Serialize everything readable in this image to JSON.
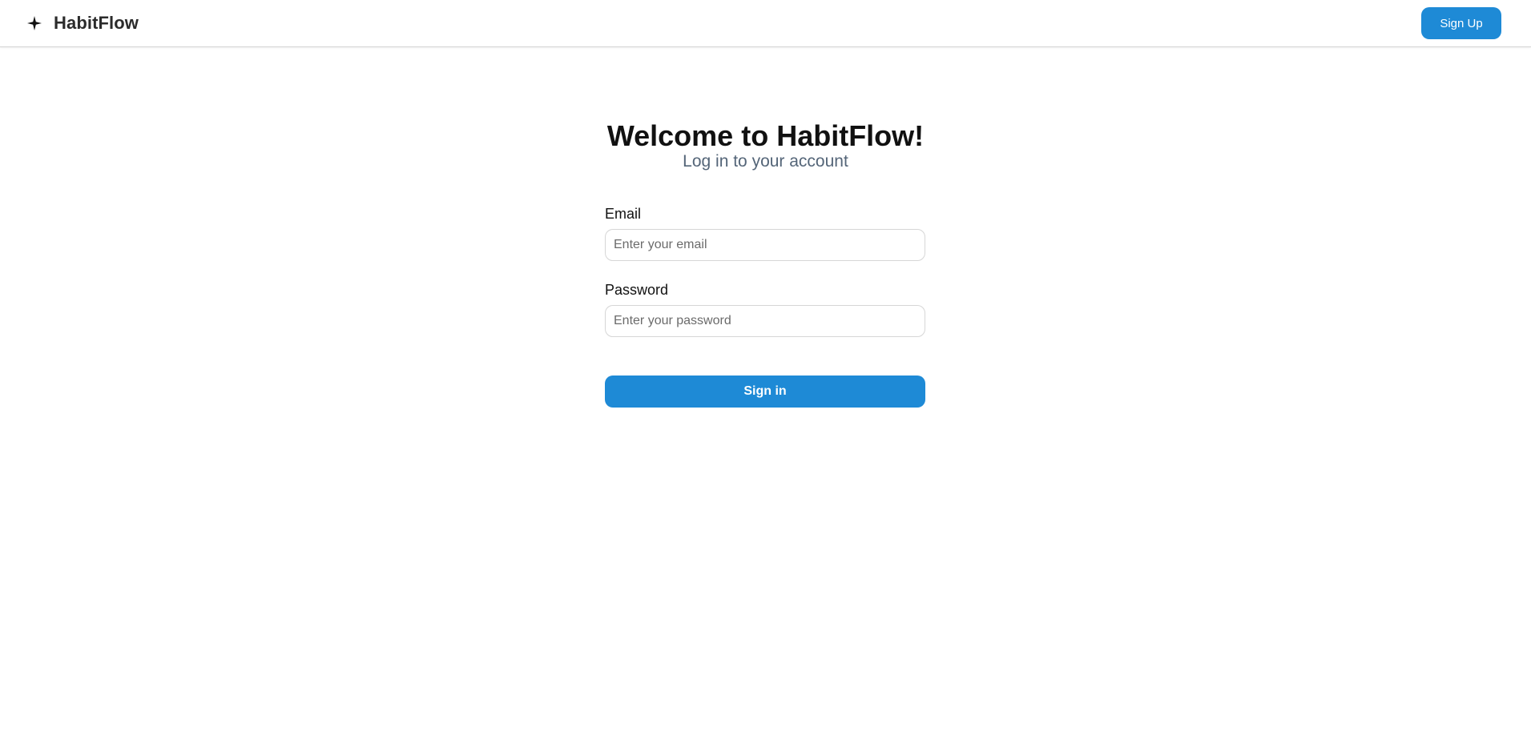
{
  "header": {
    "brand_icon": "sparkle-icon",
    "brand_name": "HabitFlow",
    "signup_label": "Sign Up"
  },
  "main": {
    "heading": "Welcome to HabitFlow!",
    "subheading": "Log in to your account"
  },
  "form": {
    "email": {
      "label": "Email",
      "value": "",
      "placeholder": "Enter your email"
    },
    "password": {
      "label": "Password",
      "value": "",
      "placeholder": "Enter your password"
    },
    "submit_label": "Sign in"
  },
  "colors": {
    "accent": "#1e8ad6",
    "subtitle": "#546578",
    "text": "#111111"
  }
}
